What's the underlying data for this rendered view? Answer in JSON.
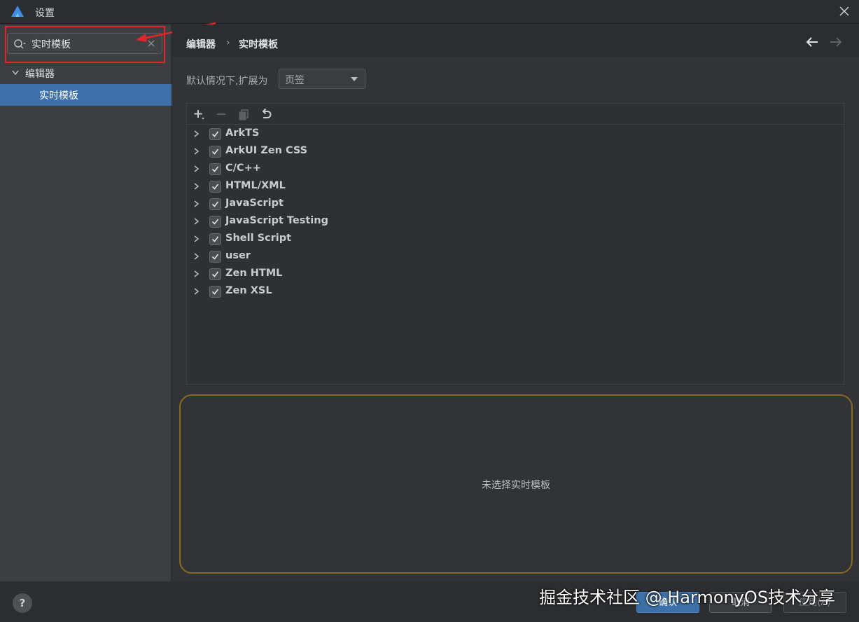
{
  "window": {
    "title": "设置",
    "close_icon": "close-icon",
    "logo_icon": "app-logo-icon"
  },
  "sidebar": {
    "search": {
      "value": "实时模板",
      "placeholder": ""
    },
    "tree": [
      {
        "label": "编辑器",
        "expanded": true
      },
      {
        "label": "实时模板",
        "selected": true
      }
    ]
  },
  "breadcrumb": {
    "parent": "编辑器",
    "separator": "›",
    "current": "实时模板"
  },
  "settings": {
    "expand_label": "默认情况下,扩展为",
    "expand_value": "页签"
  },
  "templates": {
    "toolbar": [
      "add-icon",
      "remove-icon",
      "copy-icon",
      "undo-icon"
    ],
    "groups": [
      {
        "name": "ArkTS",
        "checked": true
      },
      {
        "name": "ArkUI Zen CSS",
        "checked": true
      },
      {
        "name": "C/C++",
        "checked": true
      },
      {
        "name": "HTML/XML",
        "checked": true
      },
      {
        "name": "JavaScript",
        "checked": true
      },
      {
        "name": "JavaScript Testing",
        "checked": true
      },
      {
        "name": "Shell Script",
        "checked": true
      },
      {
        "name": "user",
        "checked": true
      },
      {
        "name": "Zen HTML",
        "checked": true
      },
      {
        "name": "Zen XSL",
        "checked": true
      }
    ]
  },
  "detail": {
    "empty_message": "未选择实时模板"
  },
  "footer": {
    "help": "?",
    "ok": "确认",
    "cancel": "取消",
    "apply": "应用(A)"
  },
  "watermark": "掘金技术社区 @ HarmonyOS技术分享",
  "colors": {
    "accent": "#3d6fa8",
    "highlight": "#e0262b",
    "detail_border": "#8a6a1e"
  }
}
